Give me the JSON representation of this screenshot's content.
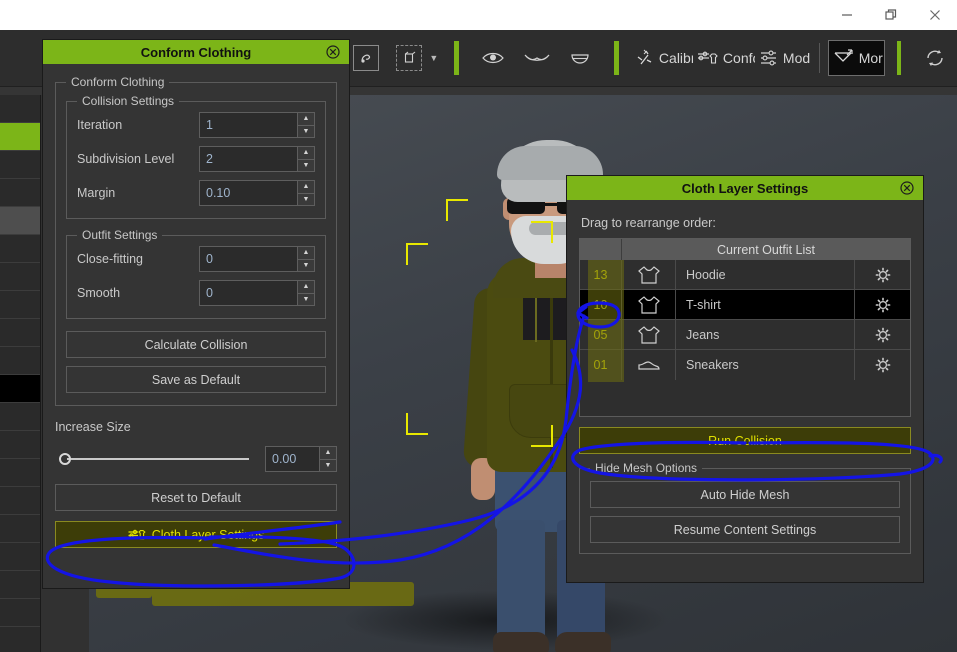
{
  "window": {
    "controls": [
      {
        "name": "minimize",
        "glyph": "minimize-icon"
      },
      {
        "name": "restore",
        "glyph": "restore-icon"
      },
      {
        "name": "close",
        "glyph": "close-icon"
      }
    ]
  },
  "toolbar": {
    "items": [
      {
        "label": "",
        "icon": "object-transform-icon"
      },
      {
        "label": "",
        "icon": "bounding-box-icon"
      },
      {
        "label": "",
        "icon": "eye-icon"
      },
      {
        "label": "",
        "icon": "eyelash-icon"
      },
      {
        "label": "",
        "icon": "mouth-icon"
      }
    ],
    "mode_buttons": [
      {
        "label": "Calibr:",
        "icon": "calibrate-icon",
        "active": false
      },
      {
        "label": "Confo",
        "icon": "conform-icon",
        "active": false
      },
      {
        "label": "Mod",
        "icon": "modify-icon",
        "active": false
      },
      {
        "label": "Mor",
        "icon": "morph-icon",
        "active": true
      }
    ],
    "refresh": {
      "label": "",
      "icon": "refresh-icon"
    }
  },
  "conform_dialog": {
    "title": "Conform Clothing",
    "close_label": "⊗",
    "outer_group": "Conform Clothing",
    "collision_group": "Collision Settings",
    "collision_fields": [
      {
        "label": "Iteration",
        "value": "1"
      },
      {
        "label": "Subdivision Level",
        "value": "2"
      },
      {
        "label": "Margin",
        "value": "0.10"
      }
    ],
    "outfit_group": "Outfit Settings",
    "outfit_fields": [
      {
        "label": "Close-fitting",
        "value": "0"
      },
      {
        "label": "Smooth",
        "value": "0"
      }
    ],
    "calculate_button": "Calculate Collision",
    "save_default_button": "Save as Default",
    "increase_size_label": "Increase Size",
    "increase_size_value": "0.00",
    "reset_button": "Reset to Default",
    "cloth_layer_button": "Cloth Layer Settings"
  },
  "cloth_layer_dialog": {
    "title": "Cloth Layer Settings",
    "close_label": "⊗",
    "drag_hint": "Drag to rearrange order:",
    "table_header": "Current Outfit List",
    "rows": [
      {
        "index": "13",
        "icon": "tshirt-icon",
        "name": "Hoodie",
        "gear": "gear-icon",
        "selected": false
      },
      {
        "index": "10",
        "icon": "tshirt-icon",
        "name": "T-shirt",
        "gear": "gear-icon",
        "selected": true
      },
      {
        "index": "05",
        "icon": "tshirt-icon",
        "name": "Jeans",
        "gear": "gear-icon",
        "selected": false
      },
      {
        "index": "01",
        "icon": "shoe-icon",
        "name": "Sneakers",
        "gear": "gear-icon",
        "selected": false
      }
    ],
    "run_collision_button": "Run Collision",
    "hide_mesh_group": "Hide Mesh Options",
    "auto_hide_button": "Auto Hide Mesh",
    "resume_button": "Resume Content Settings"
  },
  "colors": {
    "accent_green": "#7cb518",
    "gold_text": "#e0e000",
    "gold_button_bg": "#3d3d08",
    "annotation_blue": "#1414e6",
    "marker_olive": "#6f6f10",
    "selection_yellow": "#e8e800"
  }
}
